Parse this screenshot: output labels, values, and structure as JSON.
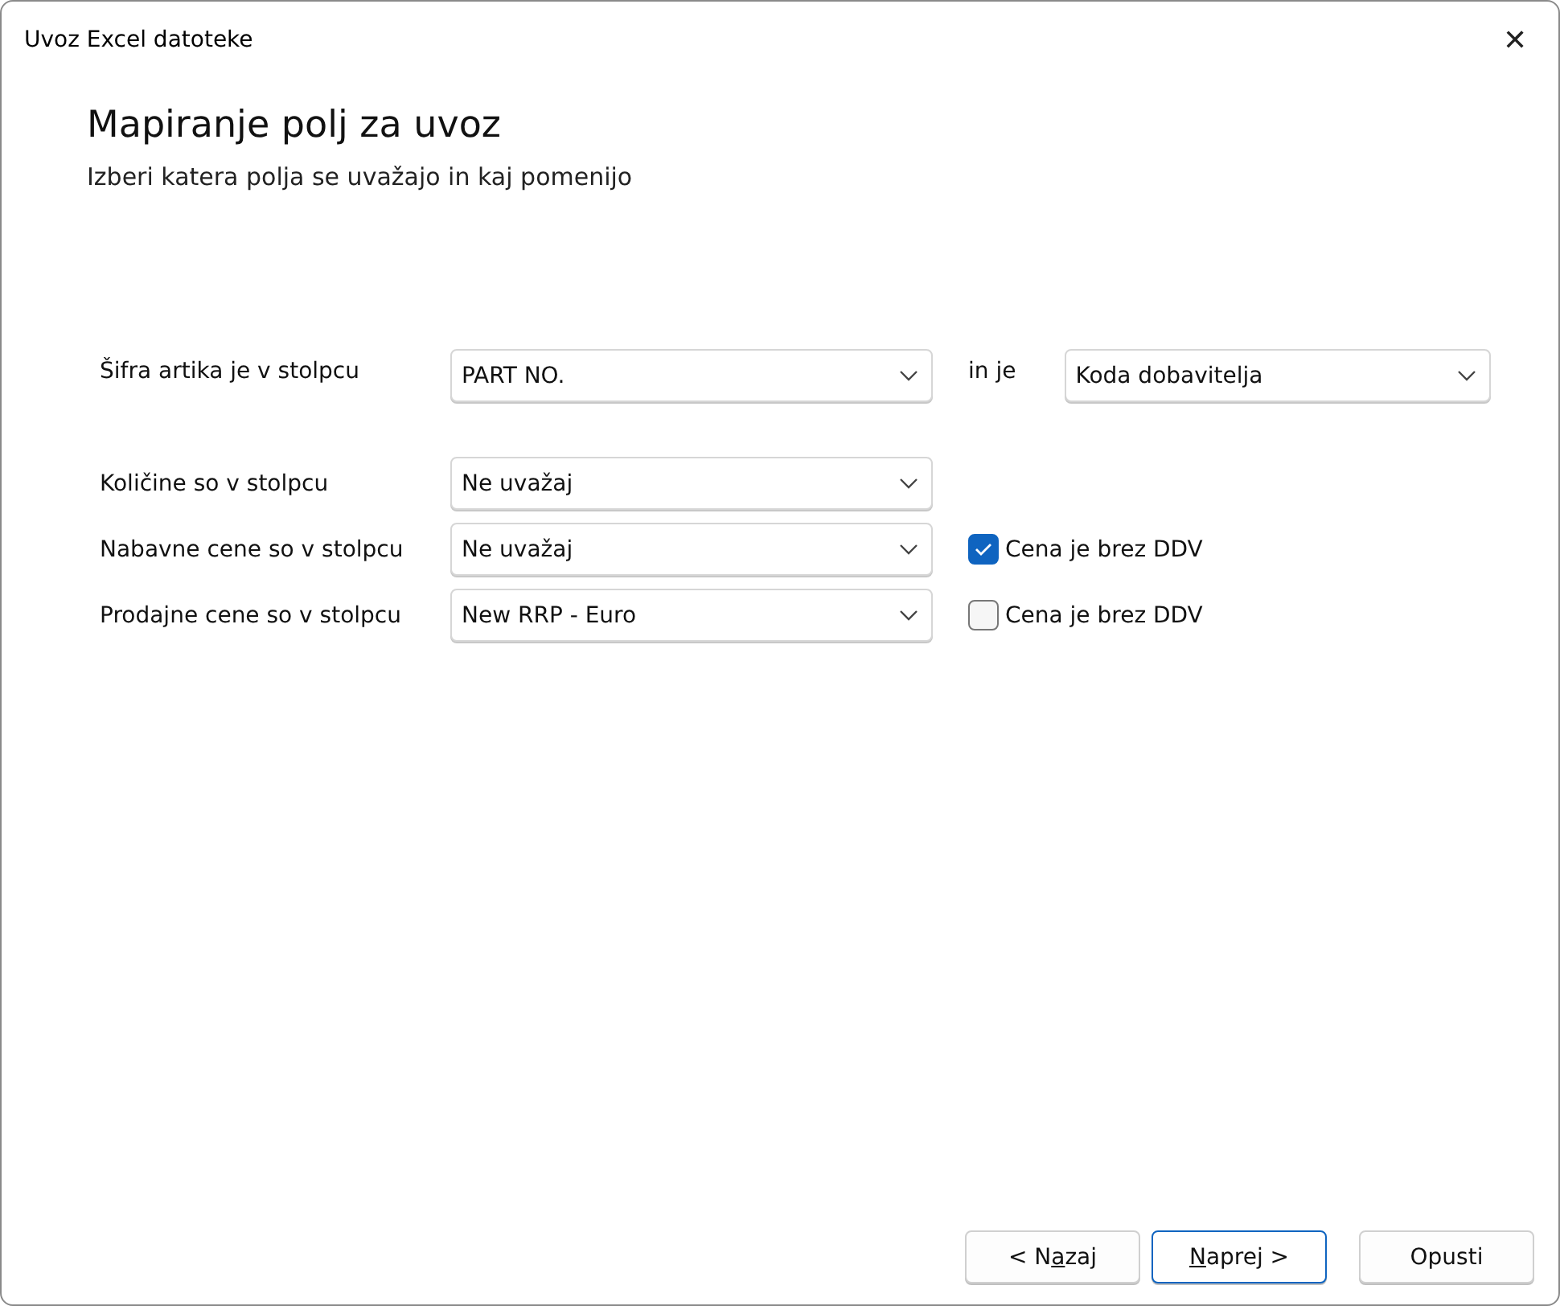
{
  "window": {
    "title": "Uvoz Excel datoteke",
    "close": "✕"
  },
  "heading": "Mapiranje polj za uvoz",
  "subheading": "Izberi katera polja se uvažajo in kaj pomenijo",
  "key_row": {
    "label": "Šifra artika je v stolpcu",
    "value": "PART NO.",
    "connector": "in je",
    "type_value": "Koda dobavitelja"
  },
  "rows": [
    {
      "label": "Količine so v stolpcu",
      "value": "Ne uvažaj"
    },
    {
      "label": "Nabavne cene so v stolpcu",
      "value": "Ne uvažaj",
      "checkbox": {
        "label": "Cena je brez DDV",
        "checked": true
      }
    },
    {
      "label": "Prodajne cene so v stolpcu",
      "value": "New RRP - Euro",
      "checkbox": {
        "label": "Cena je brez DDV",
        "checked": false
      }
    }
  ],
  "buttons": [
    {
      "before": "< N",
      "mnemonic": "a",
      "after": "zaj",
      "default": false
    },
    {
      "mnemonic": "N",
      "after": "aprej >",
      "default": true
    },
    {
      "before": "Opusti",
      "default": false
    }
  ]
}
